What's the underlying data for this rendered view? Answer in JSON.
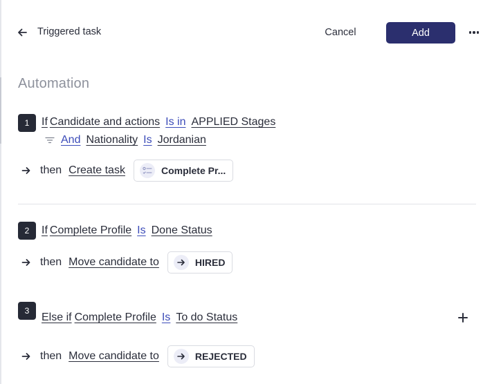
{
  "header": {
    "back_icon": "arrow-left-icon",
    "title": "Triggered task",
    "cancel_label": "Cancel",
    "add_label": "Add",
    "more_icon": "more-horizontal-icon"
  },
  "section_title": "Automation",
  "colors": {
    "primary": "#2b2f6e",
    "badge": "#262a36",
    "link_blue": "#3b4bb8",
    "muted": "#8d919c"
  },
  "rules": [
    {
      "number": "1",
      "conditions": [
        {
          "connector": "If",
          "field": "Candidate and actions",
          "operator": "Is in",
          "value": "APPLIED Stages"
        },
        {
          "connector": "And",
          "field": "Nationality",
          "operator": "Is",
          "value": "Jordanian",
          "icon": "filter-icon"
        }
      ],
      "then_word": "then",
      "action": "Create task",
      "target_label": "Complete Pr...",
      "target_icon": "checklist-icon"
    },
    {
      "number": "2",
      "conditions": [
        {
          "connector": "If",
          "field": "Complete Profile",
          "operator": "Is",
          "value": "Done Status"
        }
      ],
      "then_word": "then",
      "action": "Move candidate to",
      "target_label": "HIRED",
      "target_icon": "arrow-right-icon"
    },
    {
      "number": "3",
      "conditions": [
        {
          "connector": "Else if",
          "field": "Complete Profile",
          "operator": "Is",
          "value": "To do Status"
        }
      ],
      "then_word": "then",
      "action": "Move candidate to",
      "target_label": "REJECTED",
      "target_icon": "arrow-right-icon"
    }
  ],
  "add_condition_icon": "plus-icon"
}
